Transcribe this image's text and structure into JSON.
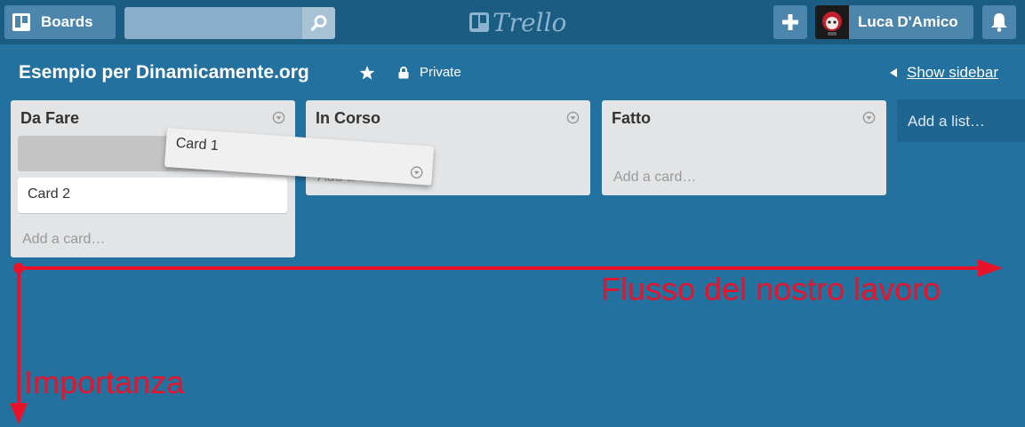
{
  "header": {
    "boards_label": "Boards",
    "search": {
      "value": "",
      "placeholder": ""
    },
    "logo_text": "Trello",
    "user_name": "Luca D'Amico"
  },
  "board": {
    "title": "Esempio per Dinamicamente.org",
    "visibility": "Private",
    "show_sidebar": "Show sidebar"
  },
  "lists": [
    {
      "title": "Da Fare",
      "cards": [
        "Card 2"
      ],
      "add_card": "Add a card…"
    },
    {
      "title": "In Corso",
      "cards": [],
      "add_card": "Add a card…"
    },
    {
      "title": "Fatto",
      "cards": [],
      "add_card": "Add a card…"
    }
  ],
  "dragging_card": "Card 1",
  "add_list": "Add a list…",
  "annotations": {
    "horizontal": "Flusso del nostro lavoro",
    "vertical": "Importanza"
  },
  "colors": {
    "board_bg": "#23719f",
    "header_bg": "#1b5c82",
    "list_bg": "#e2e4e6",
    "annotation": "#e8132b"
  },
  "icons": [
    "boards-icon",
    "search-icon",
    "trello-logo-icon",
    "plus-icon",
    "avatar",
    "bell-icon",
    "star-icon",
    "lock-icon",
    "triangle-left-icon",
    "list-menu-icon"
  ]
}
